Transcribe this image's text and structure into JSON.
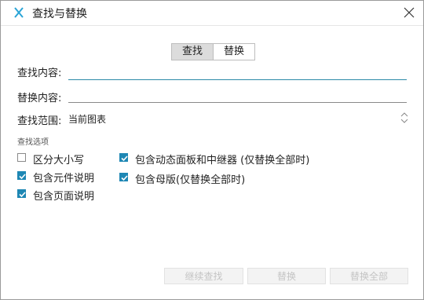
{
  "window": {
    "title": "查找与替换"
  },
  "tabs": [
    {
      "label": "查找",
      "active": true
    },
    {
      "label": "替换",
      "active": false
    }
  ],
  "find": {
    "label": "查找内容:",
    "value": ""
  },
  "replace": {
    "label": "替换内容:",
    "value": ""
  },
  "scope": {
    "label": "查找范围:",
    "value": "当前图表"
  },
  "options": {
    "section_label": "查找选项",
    "case_sensitive": {
      "label": "区分大小写",
      "checked": false
    },
    "widget_notes": {
      "label": "包含元件说明",
      "checked": true
    },
    "page_notes": {
      "label": "包含页面说明",
      "checked": true
    },
    "dynamic_panels": {
      "label": "包含动态面板和中继器 (仅替换全部时)",
      "checked": true
    },
    "masters": {
      "label": "包含母版(仅替换全部时)",
      "checked": true
    }
  },
  "buttons": {
    "find_next": "继续查找",
    "replace": "替换",
    "replace_all": "替换全部"
  },
  "colors": {
    "accent": "#1e87b4",
    "focus_underline": "#2b8aa8",
    "app_icon": "#2aa4d6"
  }
}
